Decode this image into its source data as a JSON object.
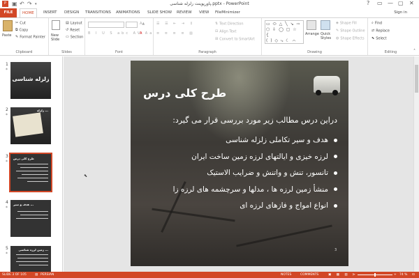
{
  "window": {
    "title": "پاورپوینت زلزله شناسی.pptx - PowerPoint",
    "controls": [
      "?",
      "▭",
      "—",
      "▢",
      "✕"
    ]
  },
  "quick_access": {
    "save_icon": "save-icon",
    "undo_icon": "undo-icon",
    "redo_icon": "redo-icon"
  },
  "ribbon_tabs": [
    "FILE",
    "HOME",
    "INSERT",
    "DESIGN",
    "TRANSITIONS",
    "ANIMATIONS",
    "SLIDE SHOW",
    "REVIEW",
    "VIEW",
    "FileMinimizer"
  ],
  "active_tab": "HOME",
  "sign_in": "Sign in",
  "ribbon": {
    "clipboard": {
      "label": "Clipboard",
      "paste": "Paste",
      "cut": "Cut",
      "copy": "Copy",
      "format_painter": "Format Painter"
    },
    "slides": {
      "label": "Slides",
      "new_slide": "New Slide",
      "layout": "Layout",
      "reset": "Reset",
      "section": "Section"
    },
    "font": {
      "label": "Font"
    },
    "paragraph": {
      "label": "Paragraph",
      "text_direction": "Text Direction",
      "align_text": "Align Text",
      "convert_smartart": "Convert to SmartArt"
    },
    "drawing": {
      "label": "Drawing",
      "arrange": "Arrange",
      "quick_styles": "Quick Styles",
      "shape_fill": "Shape Fill",
      "shape_outline": "Shape Outline",
      "shape_effects": "Shape Effects"
    },
    "editing": {
      "label": "Editing",
      "find": "Find",
      "replace": "Replace",
      "select": "Select"
    }
  },
  "thumbnails": [
    {
      "num": "1",
      "title": "زلزله شناسی"
    },
    {
      "num": "2",
      "title": "زلزله ..."
    },
    {
      "num": "3",
      "title": "طرح کلی درس",
      "selected": true
    },
    {
      "num": "4",
      "title": "هدف و سیر ..."
    },
    {
      "num": "5",
      "title": "زمین لرزه شناسی ..."
    }
  ],
  "slide": {
    "title": "طرح کلی درس",
    "intro": "دراین درس مطالب زیر مورد بررسی قرار می گیرد:",
    "bullets": [
      "هدف و سیر تکاملی زلزله شناسی",
      "لرزه خیزی و ایالتهای لرزه زمین ساخت ایران",
      "تانسور، تنش و واتنش و ضرایب الاستیک",
      "منشأ زمین لرزه ها ، مدلها و سرچشمه های لرزه زا",
      "انواع امواج و فازهای لرزه ای"
    ],
    "number": "3"
  },
  "status": {
    "slide_of": "SLIDE 3 OF 105",
    "language": "PERSIAN",
    "notes": "NOTES",
    "comments": "COMMENTS",
    "zoom": "74 %"
  },
  "colors": {
    "accent": "#d24726",
    "ribbon_bg": "#ffffff",
    "workspace": "#e5e5e5"
  }
}
